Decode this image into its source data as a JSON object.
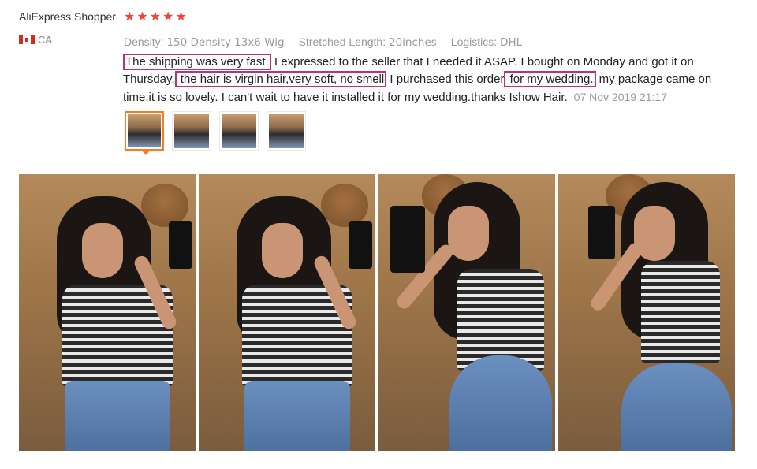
{
  "reviewer": {
    "name": "AliExpress Shopper",
    "country": "CA"
  },
  "rating": {
    "stars": 5,
    "max": 5,
    "star_color": "#f44336"
  },
  "attributes": [
    {
      "key": "Density:",
      "value": "150 Density 13x6 Wig"
    },
    {
      "key": "Stretched Length:",
      "value": "20inches"
    },
    {
      "key": "Logistics:",
      "value": "DHL"
    }
  ],
  "review": {
    "seg1_hl": "The shipping was very fast.",
    "seg2": " I expressed to the seller that I needed it ASAP. I bought on Monday and got it on Thursday.",
    "seg3_hl": " the hair is virgin hair,very soft, no smell",
    "seg4": " I purchased this order",
    "seg5_hl": " for my  wedding.",
    "seg6": " my package came on time,it is so lovely. I can't wait to have it installed it for my wedding.thanks Ishow Hair.",
    "date": "07 Nov 2019 21:17",
    "highlight_color": "#c0307a"
  },
  "thumbnails": {
    "count": 4,
    "active_index": 0,
    "active_color": "#ff7a1a"
  },
  "photos": [
    {
      "name": "review-photo-1"
    },
    {
      "name": "review-photo-2"
    },
    {
      "name": "review-photo-3"
    },
    {
      "name": "review-photo-4"
    }
  ]
}
